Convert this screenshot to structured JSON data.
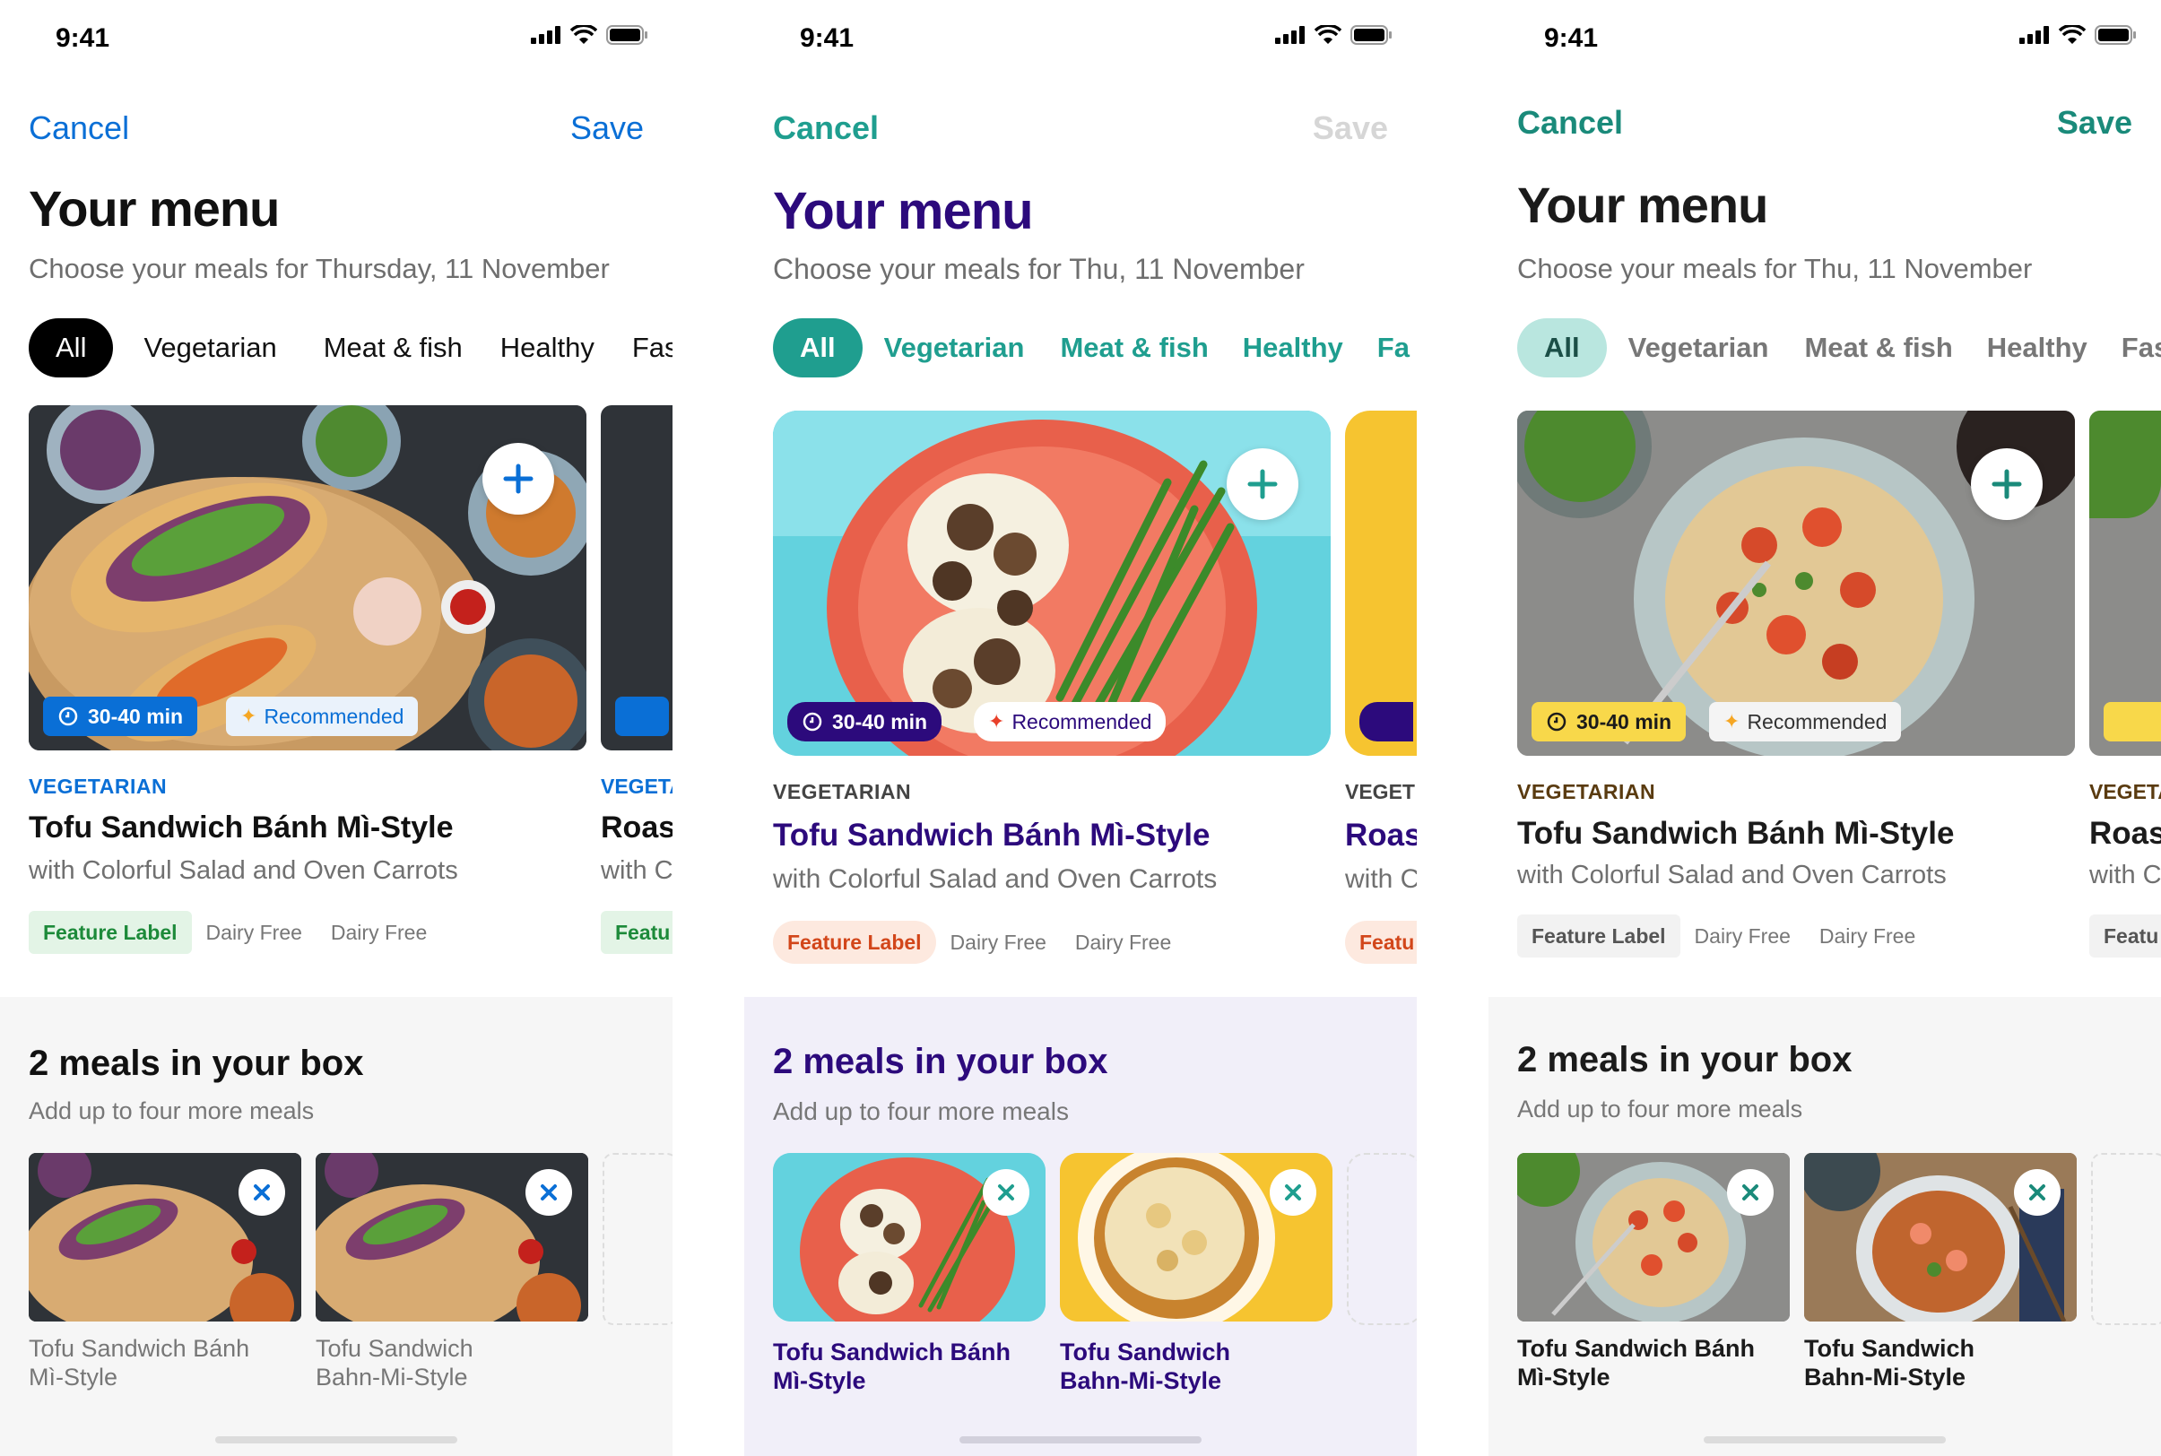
{
  "status": {
    "time": "9:41"
  },
  "variants": [
    {
      "nav": {
        "cancel": "Cancel",
        "save": "Save"
      },
      "title": "Your menu",
      "subtitle": "Choose your meals for Thursday, 11 November",
      "filters": [
        "All",
        "Vegetarian",
        "Meat & fish",
        "Healthy",
        "Fast"
      ],
      "card": {
        "time_badge": "30-40 min",
        "recommended": "Recommended",
        "category": "VEGETARIAN",
        "title": "Tofu Sandwich Bánh Mì-Style",
        "subtitle": "with Colorful Salad and Oven Carrots",
        "tags": [
          "Feature Label",
          "Dairy Free",
          "Dairy Free"
        ]
      },
      "peek": {
        "category": "VEGETA",
        "title": "Roas",
        "subtitle": "with C",
        "feature": "Featu"
      },
      "box": {
        "title": "2 meals in your box",
        "subtitle": "Add up to four more meals",
        "meals": [
          {
            "line1": "Tofu Sandwich Bánh",
            "line2": "Mì-Style"
          },
          {
            "line1": "Tofu Sandwich",
            "line2": "Bahn-Mi-Style"
          }
        ]
      },
      "colors": {
        "accent": "#0a6fd6",
        "title": "#111111",
        "feature_bg": "#e3f4e6",
        "feature_fg": "#1d8a3a"
      }
    },
    {
      "nav": {
        "cancel": "Cancel",
        "save": "Save"
      },
      "title": "Your menu",
      "subtitle": "Choose your meals for Thu, 11 November",
      "filters": [
        "All",
        "Vegetarian",
        "Meat & fish",
        "Healthy",
        "Fa"
      ],
      "card": {
        "time_badge": "30-40 min",
        "recommended": "Recommended",
        "category": "VEGETARIAN",
        "title": "Tofu Sandwich Bánh Mì-Style",
        "subtitle": "with Colorful Salad and Oven Carrots",
        "tags": [
          "Feature Label",
          "Dairy Free",
          "Dairy Free"
        ]
      },
      "peek": {
        "category": "VEGET",
        "title": "Roas",
        "subtitle": "with C",
        "feature": "Featu"
      },
      "box": {
        "title": "2 meals in your box",
        "subtitle": "Add up to four more meals",
        "meals": [
          {
            "line1": "Tofu Sandwich Bánh",
            "line2": "Mì-Style"
          },
          {
            "line1": "Tofu Sandwich",
            "line2": "Bahn-Mi-Style"
          }
        ]
      },
      "colors": {
        "accent": "#1f9e8f",
        "title": "#2c0a7c",
        "feature_bg": "#fde9df",
        "feature_fg": "#d2461a"
      }
    },
    {
      "nav": {
        "cancel": "Cancel",
        "save": "Save"
      },
      "title": "Your menu",
      "subtitle": "Choose your meals for Thu, 11 November",
      "filters": [
        "All",
        "Vegetarian",
        "Meat & fish",
        "Healthy",
        "Fast"
      ],
      "card": {
        "time_badge": "30-40 min",
        "recommended": "Recommended",
        "category": "VEGETARIAN",
        "title": "Tofu Sandwich Bánh Mì-Style",
        "subtitle": "with Colorful Salad and Oven Carrots",
        "tags": [
          "Feature Label",
          "Dairy Free",
          "Dairy Free"
        ]
      },
      "peek": {
        "category": "VEGETA",
        "title": "Roas",
        "subtitle": "with C",
        "feature": "Featu"
      },
      "box": {
        "title": "2 meals in your box",
        "subtitle": "Add up to four more meals",
        "meals": [
          {
            "line1": "Tofu Sandwich Bánh",
            "line2": "Mì-Style"
          },
          {
            "line1": "Tofu Sandwich",
            "line2": "Bahn-Mi-Style"
          }
        ]
      },
      "colors": {
        "accent": "#1a8a7a",
        "title": "#1b1b1b",
        "feature_bg": "#f2f2f2",
        "feature_fg": "#555555"
      }
    }
  ]
}
